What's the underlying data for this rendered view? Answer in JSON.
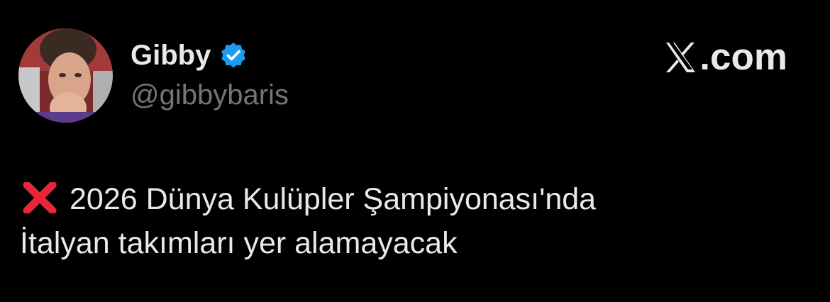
{
  "tweet": {
    "author": {
      "display_name": "Gibby",
      "handle": "@gibbybaris",
      "verified": true,
      "avatar_icon": "avatar-photo"
    },
    "brand": {
      "logo_icon": "x-logo-icon",
      "domain": ".com"
    },
    "body": {
      "emoji_icon": "cross-mark-icon",
      "line1": "2026 Dünya Kulüpler Şampiyonası'nda",
      "line2": "İtalyan takımları yer alamayacak"
    }
  },
  "colors": {
    "background": "#000000",
    "primary_text": "#e7e9ea",
    "secondary_text": "#71767b",
    "verified_badge": "#1d9bf0",
    "cross_mark": "#e8263a"
  }
}
